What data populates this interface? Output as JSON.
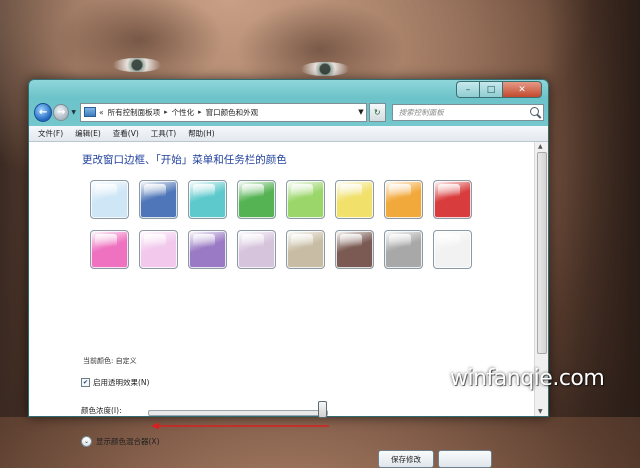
{
  "window": {
    "caption_buttons": {
      "minimize": "–",
      "maximize": "□",
      "close": "✕"
    }
  },
  "nav": {
    "back_icon": "arrow-left",
    "forward_icon": "arrow-right",
    "breadcrumb_prefix": "«",
    "breadcrumbs": [
      "所有控制面板项",
      "个性化",
      "窗口颜色和外观"
    ],
    "separator": "▸",
    "search_placeholder": "搜索控制面板"
  },
  "menu": [
    "文件(F)",
    "编辑(E)",
    "查看(V)",
    "工具(T)",
    "帮助(H)"
  ],
  "main": {
    "heading": "更改窗口边框、「开始」菜单和任务栏的颜色",
    "swatches": [
      {
        "name": "sky",
        "color": "#cfe6f7"
      },
      {
        "name": "twilight",
        "color": "#4f76b8"
      },
      {
        "name": "sea",
        "color": "#5ec9cc"
      },
      {
        "name": "leaf",
        "color": "#56b354"
      },
      {
        "name": "lime",
        "color": "#9bd66a"
      },
      {
        "name": "lemon",
        "color": "#f1e06a"
      },
      {
        "name": "tangerine",
        "color": "#f2a93c"
      },
      {
        "name": "ruby",
        "color": "#d83c3c"
      },
      {
        "name": "fuchsia",
        "color": "#ef72c0"
      },
      {
        "name": "blush",
        "color": "#f2c9ec"
      },
      {
        "name": "violet",
        "color": "#9a7ac4"
      },
      {
        "name": "lavender",
        "color": "#d6c4dc"
      },
      {
        "name": "taupe",
        "color": "#c8bda4"
      },
      {
        "name": "chocolate",
        "color": "#7a5a52"
      },
      {
        "name": "slate",
        "color": "#a8a8a8"
      },
      {
        "name": "frost",
        "color": "#f2f2f2"
      }
    ],
    "current_color_label": "当前颜色: 自定义",
    "transparency_label": "启用透明效果(N)",
    "transparency_checked": true,
    "intensity_label": "颜色浓度(I):",
    "intensity_value": 1.0,
    "mixer_label": "显示颜色混合器(X)",
    "save_button": "保存修改",
    "cancel_button": ""
  },
  "watermark": "winfanqie.com",
  "colors": {
    "accent_heading": "#1e3f9c",
    "frame": "#78c9cd",
    "arrow": "#d81f1f"
  }
}
